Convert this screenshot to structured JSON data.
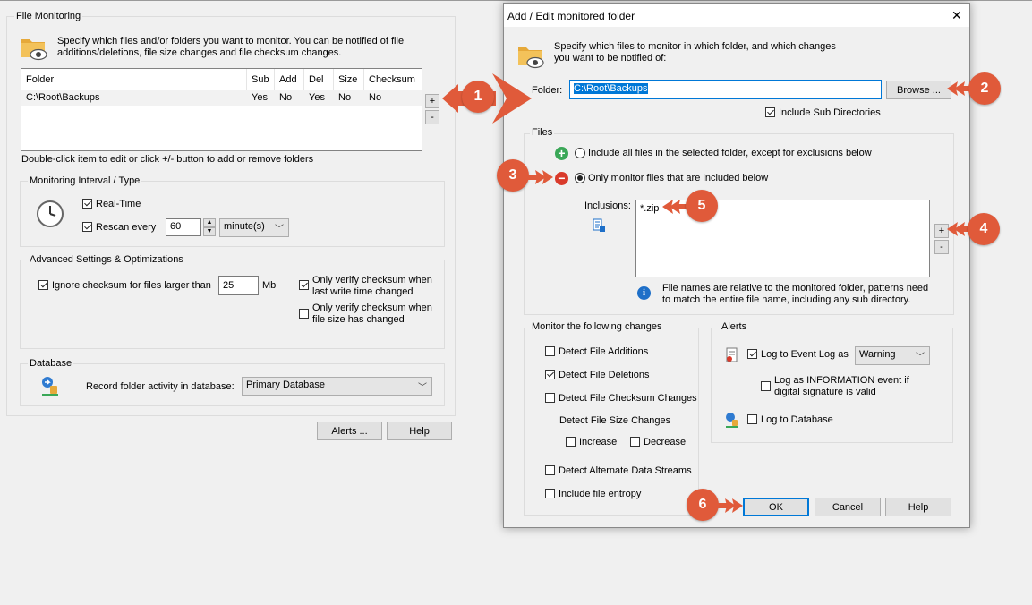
{
  "main": {
    "file_monitoring": {
      "title": "File Monitoring",
      "description_line1": "Specify which files and/or folders you want to monitor. You can be notified of file",
      "description_line2": "additions/deletions, file size changes and file checksum changes.",
      "columns": [
        "Folder",
        "Sub",
        "Add",
        "Del",
        "Size",
        "Checksum"
      ],
      "rows": [
        [
          "C:\\Root\\Backups",
          "Yes",
          "No",
          "Yes",
          "No",
          "No"
        ]
      ],
      "add_label": "+",
      "remove_label": "-",
      "hint": "Double-click item to edit or click +/- button to add or remove folders"
    },
    "interval": {
      "title": "Monitoring Interval / Type",
      "realtime_label": "Real-Time",
      "rescan_label": "Rescan every",
      "rescan_value": "60",
      "unit_value": "minute(s)"
    },
    "advanced": {
      "title": "Advanced Settings & Optimizations",
      "ignore_label": "Ignore checksum for files larger than",
      "ignore_value": "25",
      "unit": "Mb",
      "verify_write_line1": "Only verify checksum when",
      "verify_write_line2": "last write time changed",
      "verify_size_line1": "Only verify checksum when",
      "verify_size_line2": "file size has changed"
    },
    "database": {
      "title": "Database",
      "record_label": "Record folder activity in database:",
      "db_value": "Primary Database"
    },
    "alerts_button": "Alerts ...",
    "help_button": "Help"
  },
  "dialog": {
    "title": "Add / Edit monitored folder",
    "close_glyph": "✕",
    "description_line1": "Specify which files to monitor in which folder, and which changes",
    "description_line2": "you want to be notified of:",
    "folder_label": "Folder:",
    "folder_value": "C:\\Root\\Backups",
    "browse_button": "Browse ...",
    "include_sub_label": "Include Sub Directories",
    "files": {
      "title": "Files",
      "option_all": "Include all files in the selected folder, except for exclusions below",
      "option_only": "Only monitor files that are included below",
      "inclusions_label": "Inclusions:",
      "inclusion_items": [
        "*.zip"
      ],
      "add_label": "+",
      "remove_label": "-",
      "note_line1": "File names are relative to the monitored folder, patterns need",
      "note_line2": "to match the entire file name, including any sub directory."
    },
    "changes": {
      "title": "Monitor the following changes",
      "additions": "Detect File Additions",
      "deletions": "Detect File Deletions",
      "checksum": "Detect File Checksum Changes",
      "size_heading": "Detect File Size Changes",
      "increase": "Increase",
      "decrease": "Decrease",
      "streams": "Detect Alternate Data Streams",
      "entropy": "Include file entropy"
    },
    "alerts": {
      "title": "Alerts",
      "event_log_label": "Log to Event Log as",
      "event_log_level": "Warning",
      "info_line1": "Log as INFORMATION event if",
      "info_line2": "digital signature is valid",
      "db_label": "Log to Database"
    },
    "ok_button": "OK",
    "cancel_button": "Cancel",
    "help_button": "Help"
  },
  "annotations": {
    "badges": [
      "1",
      "2",
      "3",
      "4",
      "5",
      "6"
    ],
    "color": "#e05a3a"
  }
}
